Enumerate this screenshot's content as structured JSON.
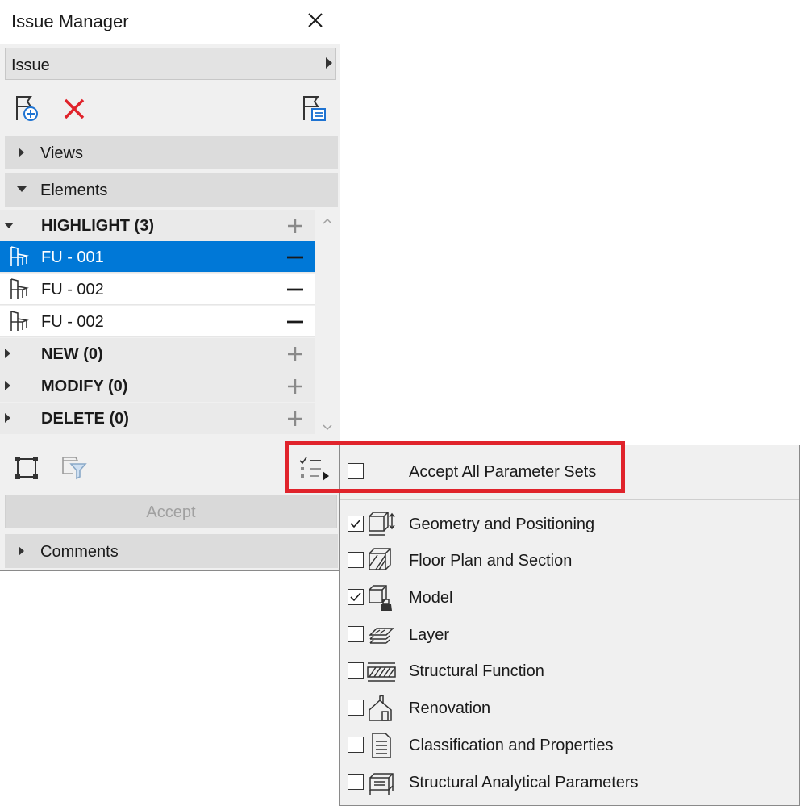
{
  "window": {
    "title": "Issue Manager"
  },
  "issue_dropdown": {
    "value": "Issue"
  },
  "sections": {
    "views": "Views",
    "elements": "Elements",
    "comments": "Comments"
  },
  "groups": [
    {
      "label": "HIGHLIGHT (3)",
      "expanded": true
    },
    {
      "label": "NEW (0)",
      "expanded": false
    },
    {
      "label": "MODIFY (0)",
      "expanded": false
    },
    {
      "label": "DELETE (0)",
      "expanded": false
    }
  ],
  "items": [
    {
      "label": "FU - 001",
      "selected": true,
      "icon": "chair-icon"
    },
    {
      "label": "FU - 002",
      "selected": false,
      "icon": "chair-icon"
    },
    {
      "label": "FU - 002",
      "selected": false,
      "icon": "chair-icon"
    }
  ],
  "accept_button": {
    "label": "Accept"
  },
  "parameter_menu": {
    "accept_all": {
      "label": "Accept All Parameter Sets",
      "checked": false
    },
    "options": [
      {
        "label": "Geometry and Positioning",
        "checked": true,
        "icon": "geometry-icon"
      },
      {
        "label": "Floor Plan and Section",
        "checked": false,
        "icon": "floor-plan-icon"
      },
      {
        "label": "Model",
        "checked": true,
        "icon": "model-icon"
      },
      {
        "label": "Layer",
        "checked": false,
        "icon": "layer-icon"
      },
      {
        "label": "Structural Function",
        "checked": false,
        "icon": "structural-function-icon"
      },
      {
        "label": "Renovation",
        "checked": false,
        "icon": "renovation-icon"
      },
      {
        "label": "Classification and Properties",
        "checked": false,
        "icon": "classification-icon"
      },
      {
        "label": "Structural Analytical Parameters",
        "checked": false,
        "icon": "structural-analytical-icon"
      }
    ]
  },
  "colors": {
    "selection": "#0078d7",
    "delete_red": "#e0232b",
    "highlight_border": "#e0232b"
  }
}
